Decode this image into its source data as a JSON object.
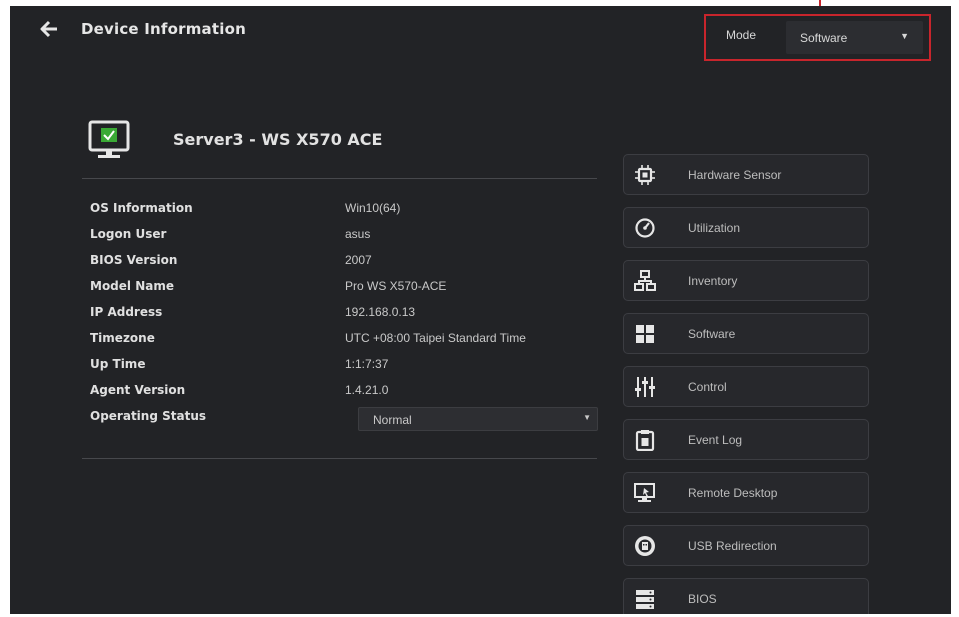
{
  "header": {
    "title": "Device Information",
    "back_icon": "arrow-left-icon"
  },
  "mode": {
    "label": "Mode",
    "selected": "Software",
    "annotation_color": "#c8252c"
  },
  "device": {
    "name": "Server3 - WS X570 ACE",
    "status_icon": "monitor-check-icon",
    "accent": "#3aa935"
  },
  "info": {
    "rows": [
      {
        "key": "OS Information",
        "value": "Win10(64)"
      },
      {
        "key": "Logon User",
        "value": "asus"
      },
      {
        "key": "BIOS Version",
        "value": "2007"
      },
      {
        "key": "Model Name",
        "value": "Pro WS X570-ACE"
      },
      {
        "key": "IP Address",
        "value": "192.168.0.13"
      },
      {
        "key": "Timezone",
        "value": "UTC +08:00 Taipei Standard Time"
      },
      {
        "key": "Up Time",
        "value": "1:1:7:37"
      },
      {
        "key": "Agent Version",
        "value": "1.4.21.0"
      }
    ],
    "status": {
      "key": "Operating Status",
      "selected": "Normal"
    }
  },
  "menu": {
    "items": [
      {
        "label": "Hardware Sensor",
        "icon": "chip-icon"
      },
      {
        "label": "Utilization",
        "icon": "gauge-icon"
      },
      {
        "label": "Inventory",
        "icon": "hierarchy-icon"
      },
      {
        "label": "Software",
        "icon": "grid-icon"
      },
      {
        "label": "Control",
        "icon": "sliders-icon"
      },
      {
        "label": "Event Log",
        "icon": "clipboard-icon"
      },
      {
        "label": "Remote Desktop",
        "icon": "remote-desktop-icon"
      },
      {
        "label": "USB Redirection",
        "icon": "usb-icon"
      },
      {
        "label": "BIOS",
        "icon": "server-stack-icon"
      }
    ]
  }
}
